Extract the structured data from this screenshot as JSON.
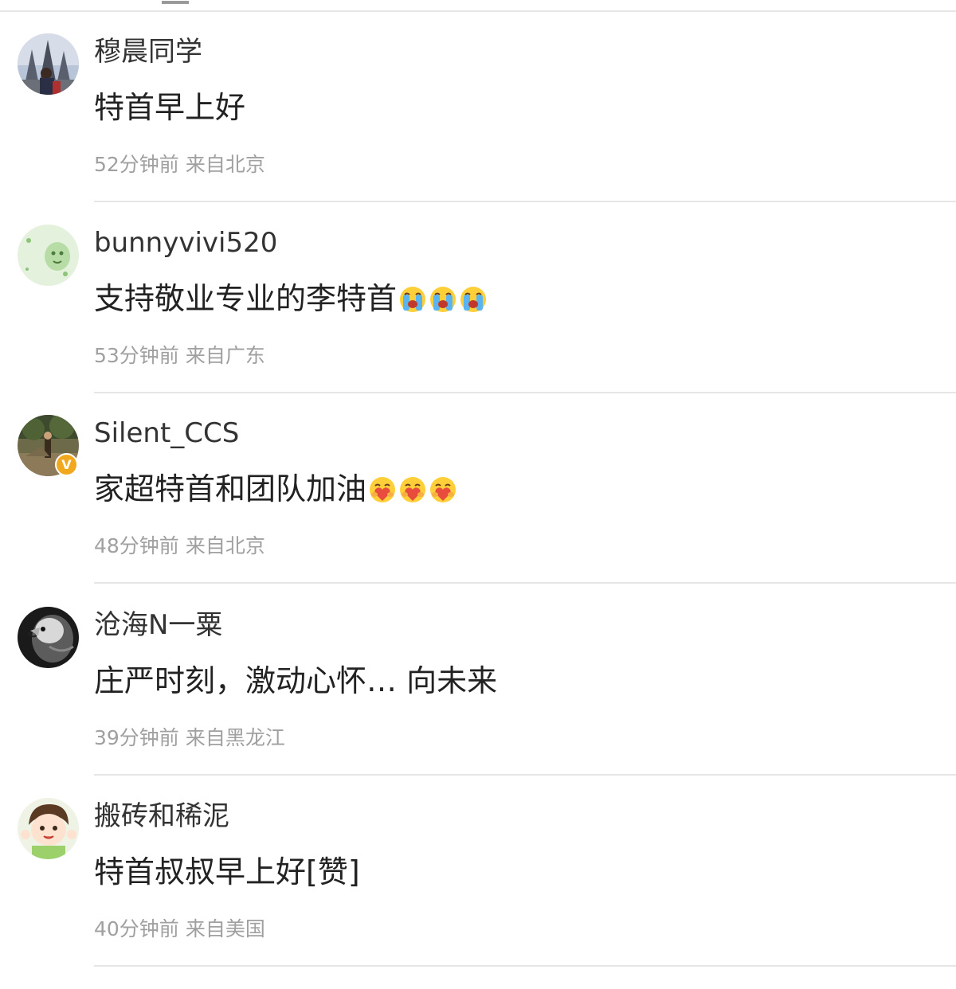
{
  "comments": [
    {
      "username": "穆晨同学",
      "text": "特首早上好",
      "time": "52分钟前",
      "location": "来自北京",
      "avatar": "castle-portrait-avatar",
      "verified": false
    },
    {
      "username": "bunnyvivi520",
      "text": "支持敬业专业的李特首",
      "emoji": [
        "crying-emoji",
        "crying-emoji",
        "crying-emoji"
      ],
      "time": "53分钟前",
      "location": "来自广东",
      "avatar": "green-cartoon-avatar",
      "verified": false
    },
    {
      "username": "Silent_CCS",
      "text": "家超特首和团队加油",
      "emoji": [
        "heart-hug-emoji",
        "heart-hug-emoji",
        "heart-hug-emoji"
      ],
      "time": "48分钟前",
      "location": "来自北京",
      "avatar": "forest-photo-avatar",
      "verified": true,
      "verified_badge": "V"
    },
    {
      "username": "沧海N一粟",
      "text": "庄严时刻，激动心怀… 向未来",
      "time": "39分钟前",
      "location": "来自黑龙江",
      "avatar": "eagle-avatar",
      "verified": false
    },
    {
      "username": "搬砖和稀泥",
      "text": "特首叔叔早上好[赞]",
      "time": "40分钟前",
      "location": "来自美国",
      "avatar": "cartoon-boy-avatar",
      "verified": false
    }
  ],
  "colors": {
    "username": "#333333",
    "text": "#222222",
    "meta": "#a0a0a0",
    "divider": "#e6e6e6",
    "verified": "#f2a81c"
  }
}
